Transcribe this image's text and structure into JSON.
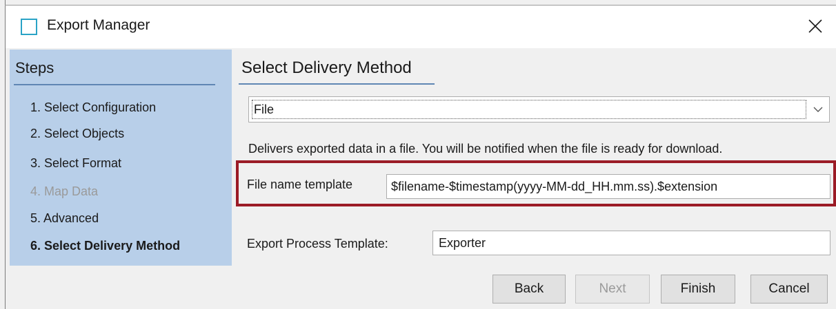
{
  "window": {
    "title": "Export Manager"
  },
  "steps": {
    "title": "Steps",
    "items": [
      {
        "label": "1. Select Configuration",
        "state": "normal"
      },
      {
        "label": "2. Select Objects",
        "state": "normal"
      },
      {
        "label": "3. Select Format",
        "state": "normal"
      },
      {
        "label": "4. Map Data",
        "state": "disabled"
      },
      {
        "label": "5. Advanced",
        "state": "normal"
      },
      {
        "label": "6. Select Delivery Method",
        "state": "active"
      }
    ]
  },
  "main": {
    "section_title": "Select Delivery Method",
    "delivery_select": {
      "value": "File"
    },
    "description": "Delivers exported data in a file. You will be notified when the file is ready for download.",
    "file_name_template": {
      "label": "File name template",
      "value": "$filename-$timestamp(yyyy-MM-dd_HH.mm.ss).$extension"
    },
    "export_process_template": {
      "label": "Export Process Template:",
      "value": "Exporter"
    }
  },
  "buttons": {
    "back": "Back",
    "next": "Next",
    "finish": "Finish",
    "cancel": "Cancel"
  },
  "colors": {
    "steps_panel": "#b8cfe9",
    "highlight_border": "#9b1b26",
    "icon_accent": "#2aa3c6"
  },
  "icons": [
    "window-icon",
    "close-icon",
    "chevron-down-icon"
  ]
}
